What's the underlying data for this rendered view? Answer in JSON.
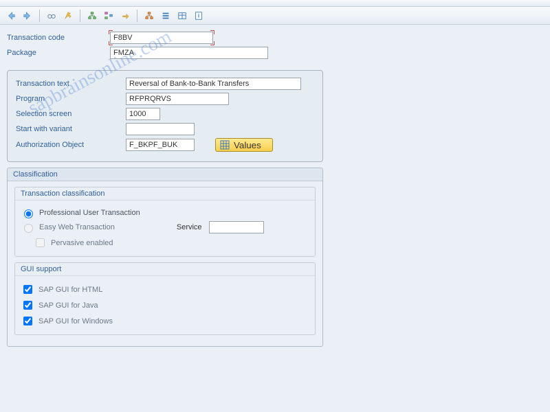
{
  "watermark": "sapbrainsonline.com",
  "toolbar": {
    "icons": [
      "back",
      "forward",
      "sep",
      "glasses",
      "tool",
      "sep",
      "org1",
      "org2",
      "org3",
      "sep",
      "hier1",
      "hier2",
      "hier3",
      "doc"
    ]
  },
  "header": {
    "tcode_label": "Transaction code",
    "tcode_value": "F8BV",
    "package_label": "Package",
    "package_value": "FMZA"
  },
  "details": {
    "text_label": "Transaction text",
    "text_value": "Reversal of Bank-to-Bank Transfers",
    "program_label": "Program",
    "program_value": "RFPRQRVS",
    "selscreen_label": "Selection screen",
    "selscreen_value": "1000",
    "variant_label": "Start with variant",
    "variant_value": "",
    "authobj_label": "Authorization Object",
    "authobj_value": "F_BKPF_BUK",
    "values_btn": "Values"
  },
  "classification": {
    "title": "Classification",
    "trans_class_title": "Transaction classification",
    "r_prof": "Professional User Transaction",
    "r_easy": "Easy Web Transaction",
    "service_label": "Service",
    "service_value": "",
    "c_pervasive": "Pervasive enabled",
    "gui_title": "GUI support",
    "c_html": "SAP GUI for HTML",
    "c_java": "SAP GUI for Java",
    "c_win": "SAP GUI for Windows"
  }
}
